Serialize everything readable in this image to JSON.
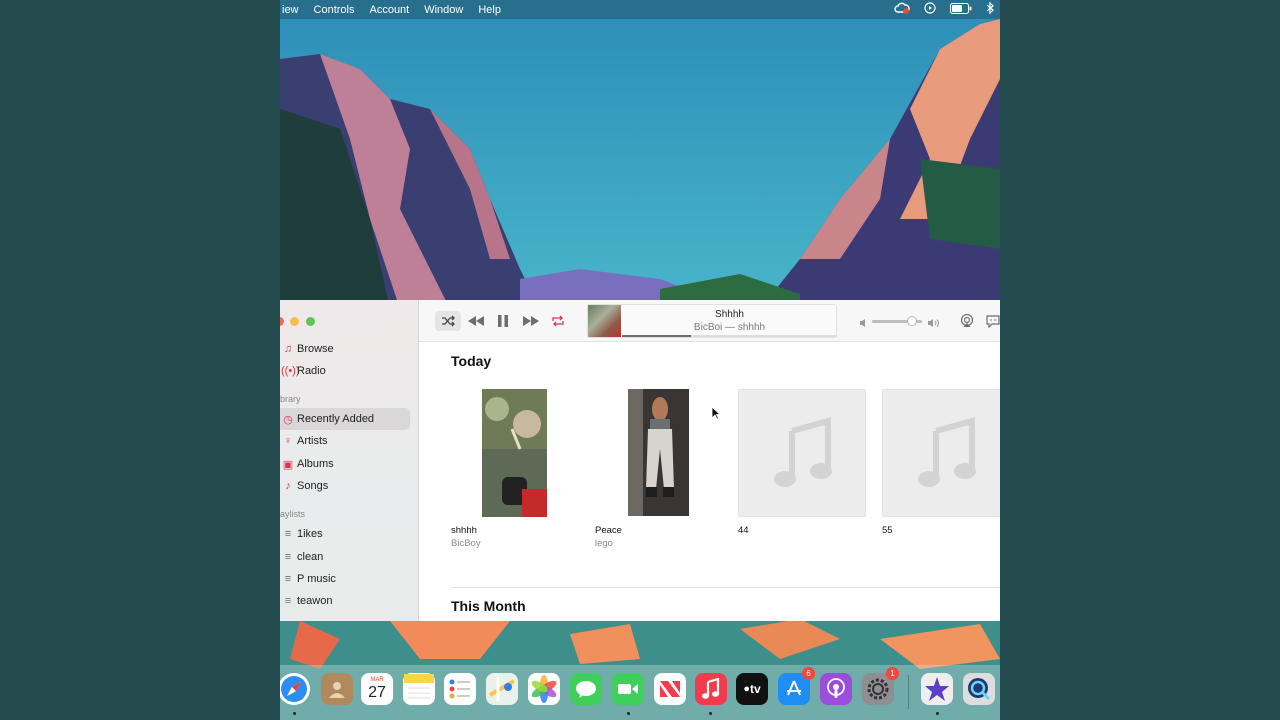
{
  "menubar": {
    "items": [
      "iew",
      "Controls",
      "Account",
      "Window",
      "Help"
    ]
  },
  "sidebar": {
    "top_items": [
      {
        "label": "Browse",
        "icon": "music-note-icon"
      },
      {
        "label": "Radio",
        "icon": "radio-waves-icon"
      }
    ],
    "library_heading": "brary",
    "library_items": [
      {
        "label": "Recently Added",
        "icon": "clock-icon",
        "selected": true
      },
      {
        "label": "Artists",
        "icon": "microphone-icon"
      },
      {
        "label": "Albums",
        "icon": "album-icon"
      },
      {
        "label": "Songs",
        "icon": "music-note-icon"
      }
    ],
    "playlists_heading": "aylists",
    "playlists": [
      {
        "label": "1ikes"
      },
      {
        "label": "clean"
      },
      {
        "label": "P music"
      },
      {
        "label": "teawon"
      }
    ]
  },
  "player": {
    "track_title": "Shhhh",
    "track_subtitle": "BicBoi — shhhh",
    "progress": 0.32,
    "volume": 0.8
  },
  "content": {
    "section_today": "Today",
    "section_month": "This Month",
    "cards": [
      {
        "name": "shhhh",
        "artist": "BicBoy"
      },
      {
        "name": "Peace",
        "artist": "lego"
      },
      {
        "name": "44",
        "artist": ""
      },
      {
        "name": "55",
        "artist": ""
      }
    ]
  },
  "dock": {
    "calendar_month": "MAR",
    "calendar_day": "27",
    "app_store_badge": "6",
    "settings_badge": "1",
    "tv_label": "tv"
  },
  "colors": {
    "accent": "#e0334c",
    "sidebar_selected": "#d9d7d8"
  }
}
